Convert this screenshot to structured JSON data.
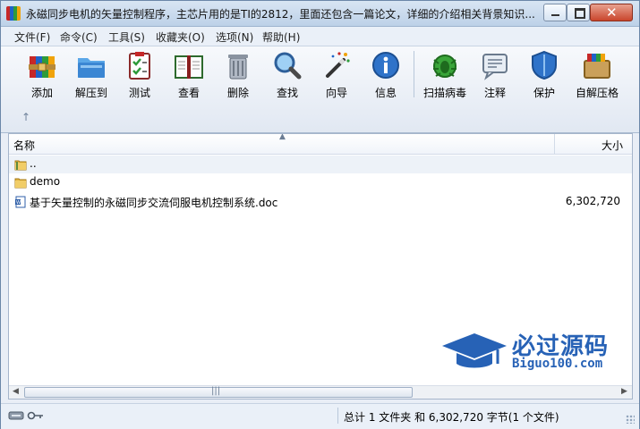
{
  "window": {
    "title": "永磁同步电机的矢量控制程序，主芯片用的是TI的2812，里面还包含一篇论文，详细的介绍相关背景知识..."
  },
  "menu": [
    "文件(F)",
    "命令(C)",
    "工具(S)",
    "收藏夹(O)",
    "选项(N)",
    "帮助(H)"
  ],
  "toolbar": {
    "add": "添加",
    "extract": "解压到",
    "test": "测试",
    "view": "查看",
    "delete": "删除",
    "find": "查找",
    "wizard": "向导",
    "info": "信息",
    "scan": "扫描病毒",
    "comment": "注释",
    "protect": "保护",
    "sfx": "自解压格"
  },
  "nav": {
    "up_arrow": "↑"
  },
  "columns": {
    "name": "名称",
    "size": "大小"
  },
  "files": [
    {
      "name": "..",
      "size": "",
      "type": "folder-up"
    },
    {
      "name": "demo",
      "size": "",
      "type": "folder"
    },
    {
      "name": "基于矢量控制的永磁同步交流伺服电机控制系统.doc",
      "size": "6,302,720",
      "type": "doc"
    }
  ],
  "status": {
    "text": "总计 1 文件夹 和 6,302,720 字节(1 个文件)"
  },
  "watermark": {
    "title": "必过源码",
    "url": "Biguo100.com"
  },
  "colors": {
    "accent": "#2762b6",
    "selection": "#edf2f8"
  }
}
